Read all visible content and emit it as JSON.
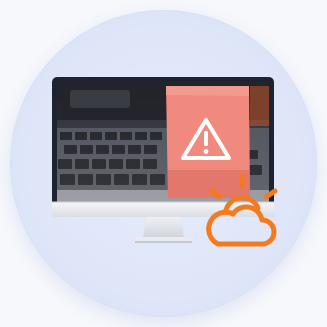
{
  "illustration": {
    "subject": "monitor-error-weather",
    "colors": {
      "halo_background": "#dfe6f8",
      "monitor_bezel": "#1f2230",
      "monitor_stand": "#e4e7ee",
      "warning_panel": "#f08a7e",
      "warning_icon": "#ffffff",
      "weather_icon": "#f47a20"
    },
    "icons": {
      "warning": "warning-icon",
      "weather": "partly-cloudy-sun-icon"
    }
  }
}
